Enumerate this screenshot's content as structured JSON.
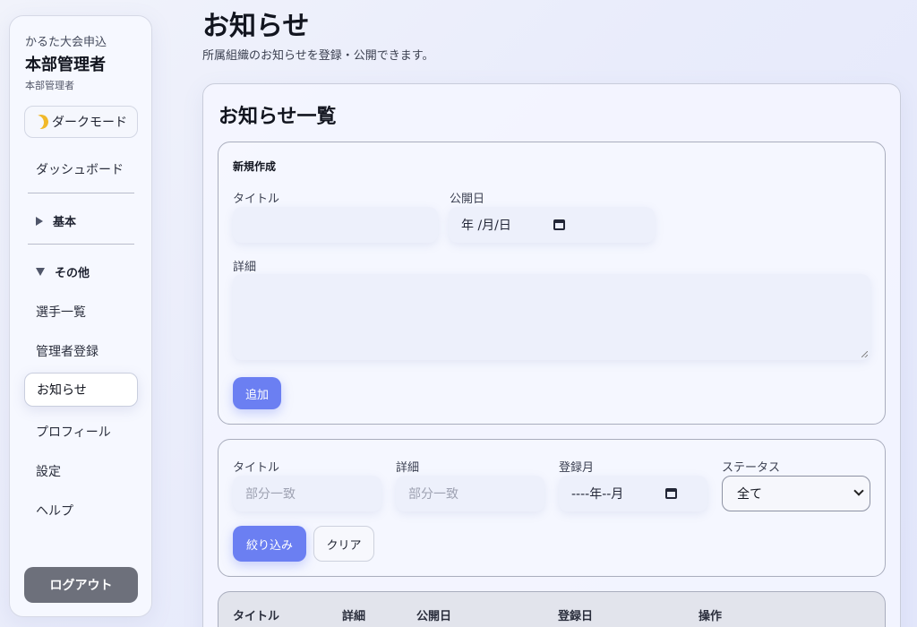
{
  "sidebar": {
    "app_name": "かるた大会申込",
    "role_title": "本部管理者",
    "role_sub": "本部管理者",
    "dark_mode_label": "ダークモード",
    "dashboard": "ダッシュボード",
    "group_basic": "基本",
    "group_other": "その他",
    "items": [
      "選手一覧",
      "管理者登録",
      "お知らせ",
      "プロフィール",
      "設定",
      "ヘルプ"
    ],
    "logout": "ログアウト"
  },
  "page": {
    "title": "お知らせ",
    "description": "所属組織のお知らせを登録・公開できます。"
  },
  "card": {
    "title": "お知らせ一覧",
    "create": {
      "heading": "新規作成",
      "title_label": "タイトル",
      "title_value": "",
      "date_label": "公開日",
      "date_value": "年 /月/日",
      "detail_label": "詳細",
      "detail_value": "",
      "add_button": "追加"
    },
    "filter": {
      "title_label": "タイトル",
      "title_placeholder": "部分一致",
      "detail_label": "詳細",
      "detail_placeholder": "部分一致",
      "month_label": "登録月",
      "month_value": "----年--月",
      "status_label": "ステータス",
      "status_value": "全て",
      "filter_button": "絞り込み",
      "clear_button": "クリア"
    },
    "table": {
      "columns": [
        "タイトル",
        "詳細",
        "公開日",
        "登録日",
        "操作"
      ]
    }
  },
  "colors": {
    "primary": "#6b7ff2",
    "logout": "#6d707b",
    "moon": "#f1b92a"
  }
}
